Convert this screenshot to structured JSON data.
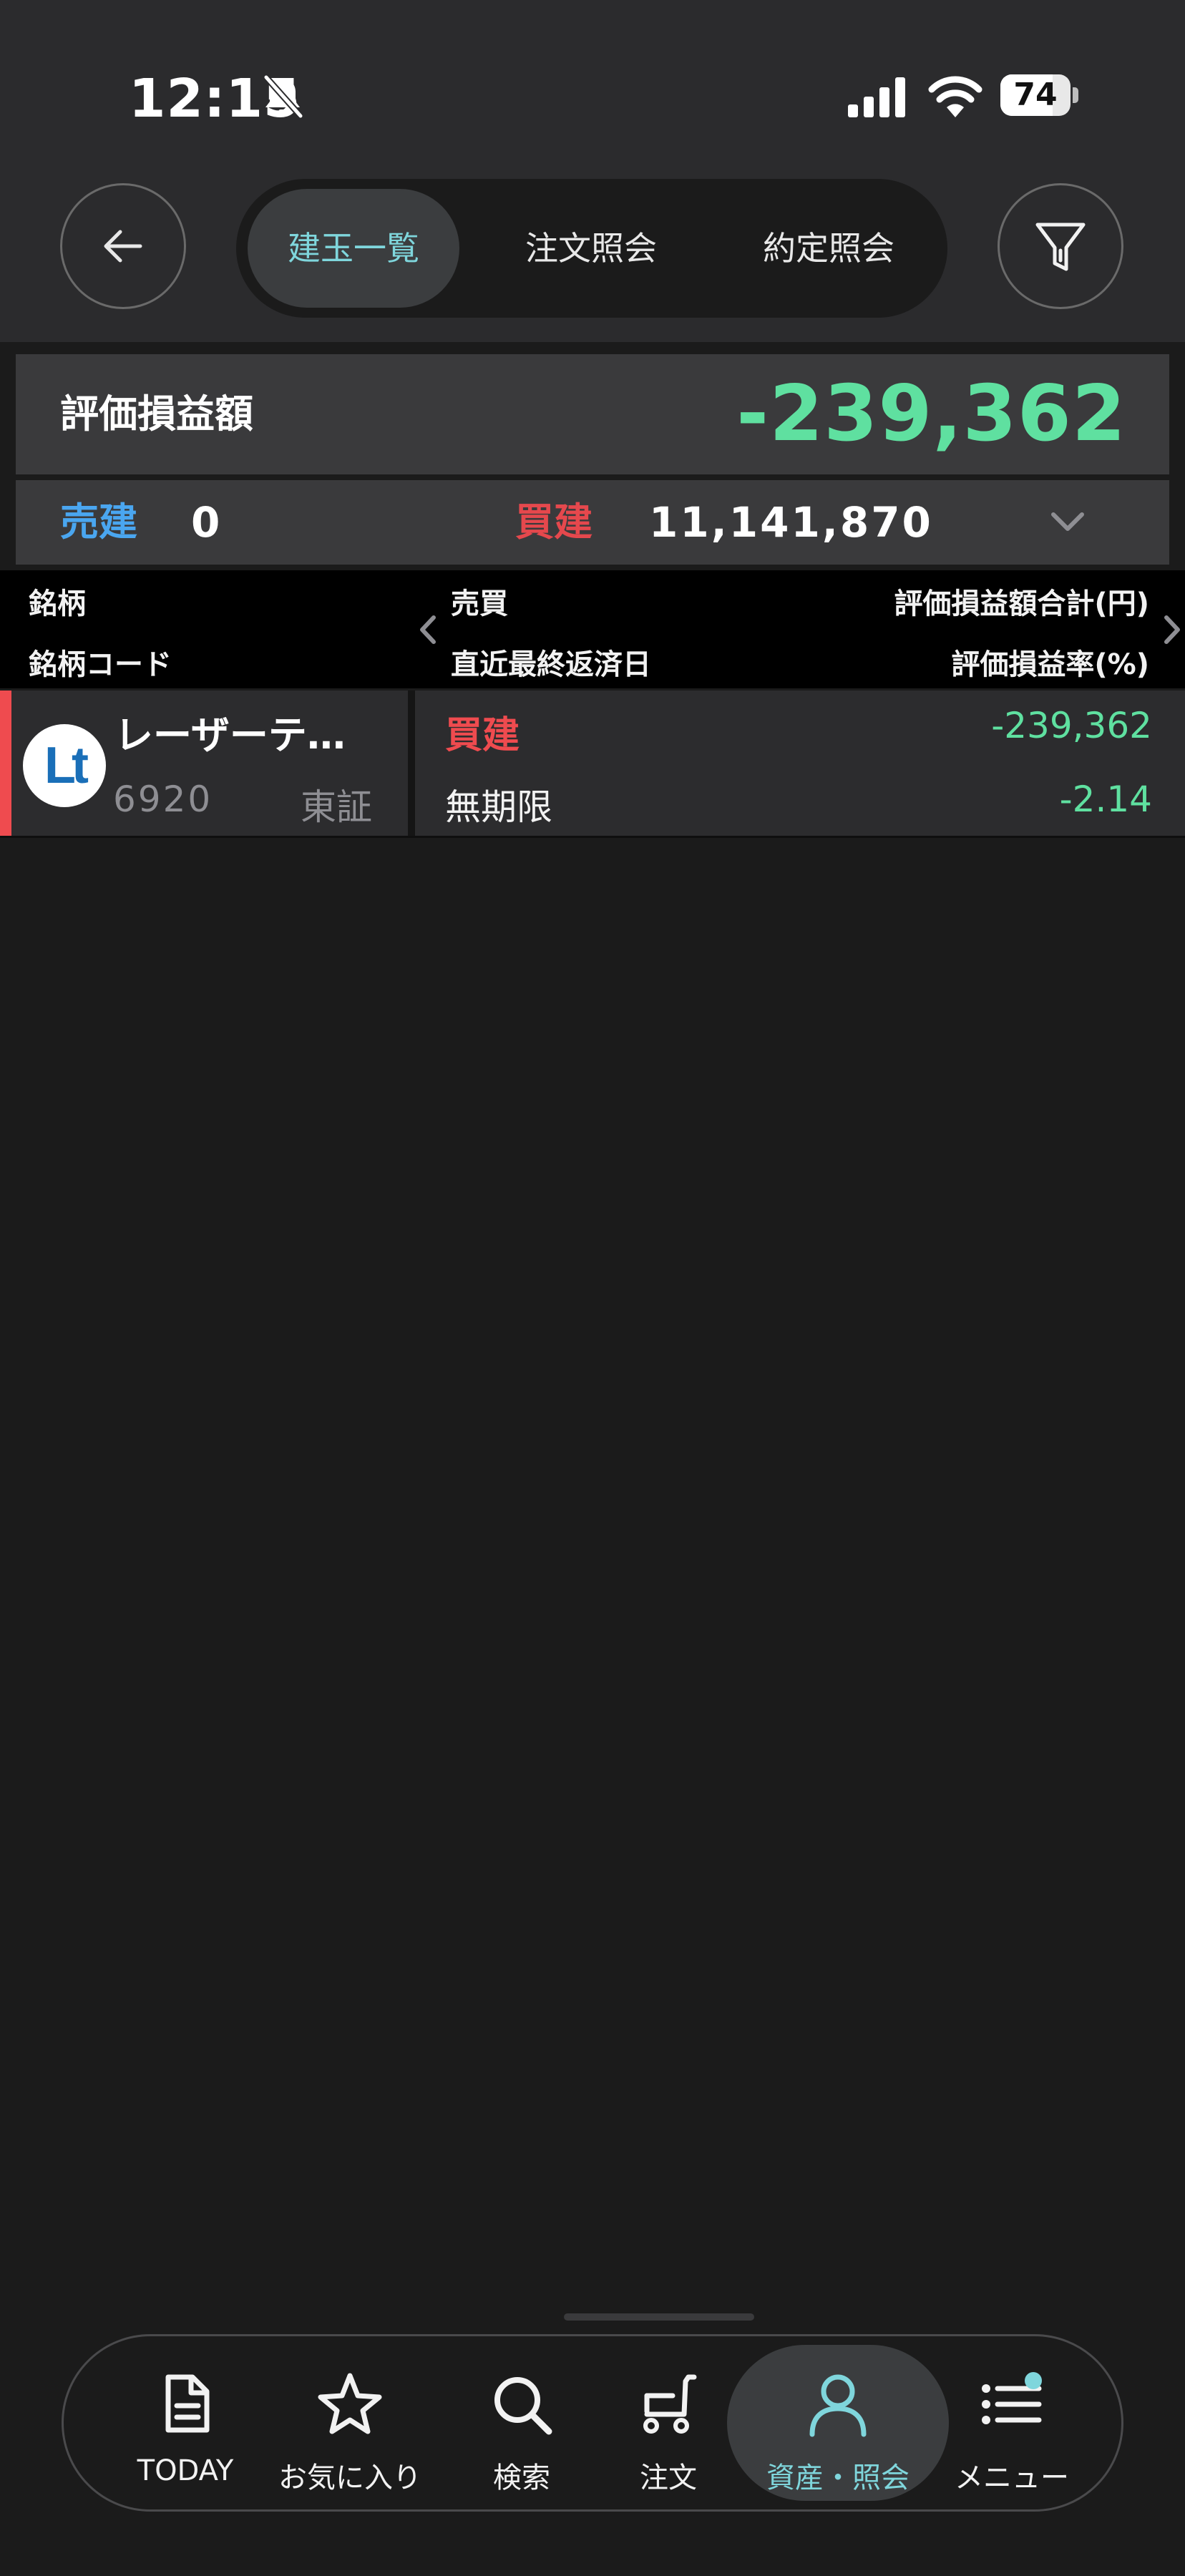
{
  "status_bar": {
    "time": "12:15",
    "battery": "74",
    "battery_level": 0.74,
    "icons": [
      "bell-slash-icon",
      "cellular-signal-icon",
      "wifi-icon",
      "battery-icon"
    ]
  },
  "header": {
    "back_icon": "arrow-left-icon",
    "tabs": [
      {
        "label": "建玉一覧",
        "active": true
      },
      {
        "label": "注文照会",
        "active": false
      },
      {
        "label": "約定照会",
        "active": false
      }
    ],
    "filter_icon": "filter-funnel-icon"
  },
  "summary": {
    "label": "評価損益額",
    "value": "-239,362",
    "sell_label": "売建",
    "sell_value": "0",
    "buy_label": "買建",
    "buy_value": "11,141,870",
    "expand_icon": "chevron-down-icon"
  },
  "columns": {
    "col1_line1": "銘柄",
    "col1_line2": "銘柄コード",
    "col2_line1": "売買",
    "col2_line2": "直近最終返済日",
    "col3_line1": "評価損益額合計(円)",
    "col3_line2": "評価損益率(%)",
    "prev_icon": "chevron-left-icon",
    "next_icon": "chevron-right-icon"
  },
  "positions": [
    {
      "logo": "Lt",
      "name": "レーザーテ…",
      "code": "6920",
      "market": "東証",
      "type": "買建",
      "deadline": "無期限",
      "pl": "-239,362",
      "rate": "-2.14"
    }
  ],
  "bottom_nav": {
    "items": [
      {
        "label": "TODAY",
        "icon": "document-icon",
        "active": false
      },
      {
        "label": "お気に入り",
        "icon": "star-icon",
        "active": false
      },
      {
        "label": "検索",
        "icon": "search-icon",
        "active": false
      },
      {
        "label": "注文",
        "icon": "cart-icon",
        "active": false
      },
      {
        "label": "資産・照会",
        "icon": "person-icon",
        "active": true
      },
      {
        "label": "メニュー",
        "icon": "list-menu-icon",
        "active": false
      }
    ]
  },
  "colors": {
    "accent": "#7fd6dc",
    "profit_green": "#5fe0a0",
    "buy_red": "#ef4b4f",
    "sell_blue": "#4aa6f0"
  }
}
